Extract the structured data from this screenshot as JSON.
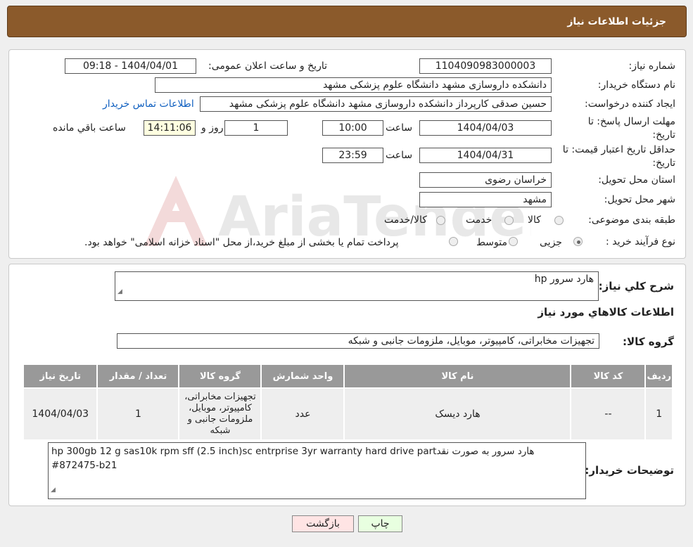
{
  "header": {
    "title": "جزئیات اطلاعات نیاز"
  },
  "form": {
    "need_number_label": "شماره نیاز:",
    "need_number": "1104090983000003",
    "announce_label": "تاریخ و ساعت اعلان عمومی:",
    "announce_value": "1404/04/01 - 09:18",
    "buyer_org_label": "نام دستگاه خريدار:",
    "buyer_org": "دانشکده داروسازی مشهد   دانشگاه علوم پزشکی مشهد",
    "creator_label": "ايجاد کننده درخواست:",
    "creator": "حسین صدقی کارپرداز دانشکده داروسازی مشهد   دانشگاه علوم پزشکی مشهد",
    "contact_link": "اطلاعات تماس خریدار",
    "deadline_label_1": "مهلت ارسال پاسخ: تا",
    "deadline_label_2": "تاریخ:",
    "deadline_date": "1404/04/03",
    "time_label": "ساعت",
    "deadline_time": "10:00",
    "days_value": "1",
    "days_label": "روز و",
    "remaining_time": "14:11:06",
    "remaining_label": "ساعت باقي مانده",
    "validity_label_1": "حداقل تاريخ اعتبار قيمت: تا",
    "validity_label_2": "تاریخ:",
    "validity_date": "1404/04/31",
    "validity_time": "23:59",
    "province_label": "استان محل تحويل:",
    "province": "خراسان رضوی",
    "city_label": "شهر محل تحويل:",
    "city": "مشهد",
    "category_label": "طبقه بندی موضوعی:",
    "category_options": [
      "کالا",
      "خدمت",
      "کالا/خدمت"
    ],
    "process_label": "نوع فرآيند خريد :",
    "process_options": [
      "جزیی",
      "متوسط"
    ],
    "process_note": "پرداخت تمام یا بخشی از مبلغ خرید،از محل \"اسناد خزانه اسلامی\" خواهد بود."
  },
  "details": {
    "summary_label": "شرح کلي نياز:",
    "summary": "هارد سرور hp",
    "goods_info_title": "اطلاعات کالاهاي مورد نياز",
    "goods_group_label": "گروه کالا:",
    "goods_group": "تجهیزات مخابراتی، کامپیوتر، موبایل، ملزومات جانبی و شبکه",
    "table": {
      "headers": [
        "رديف",
        "کد کالا",
        "نام کالا",
        "واحد شمارش",
        "گروه کالا",
        "تعداد / مقدار",
        "تاريخ نياز"
      ],
      "rows": [
        [
          "1",
          "--",
          "هارد دیسک",
          "عدد",
          "تجهیزات مخابراتی، کامپیوتر، موبایل، ملزومات جانبی و شبکه",
          "1",
          "1404/04/03"
        ]
      ]
    },
    "buyer_notes_label": "توضيحات خريدار:",
    "buyer_notes": "هارد سرور  به صورت نقدhp 300gb 12 g sas10k rpm sff (2.5 inch)sc entrprise 3yr warranty hard  drive part #872475-b21"
  },
  "buttons": {
    "print": "چاپ",
    "back": "بازگشت"
  },
  "watermark": {
    "text": "AriaTender.net"
  },
  "colors": {
    "header_bg": "#8b5a2b",
    "link": "#1060c0",
    "print_bg": "#e8ffe0",
    "back_bg": "#ffe4e4"
  }
}
